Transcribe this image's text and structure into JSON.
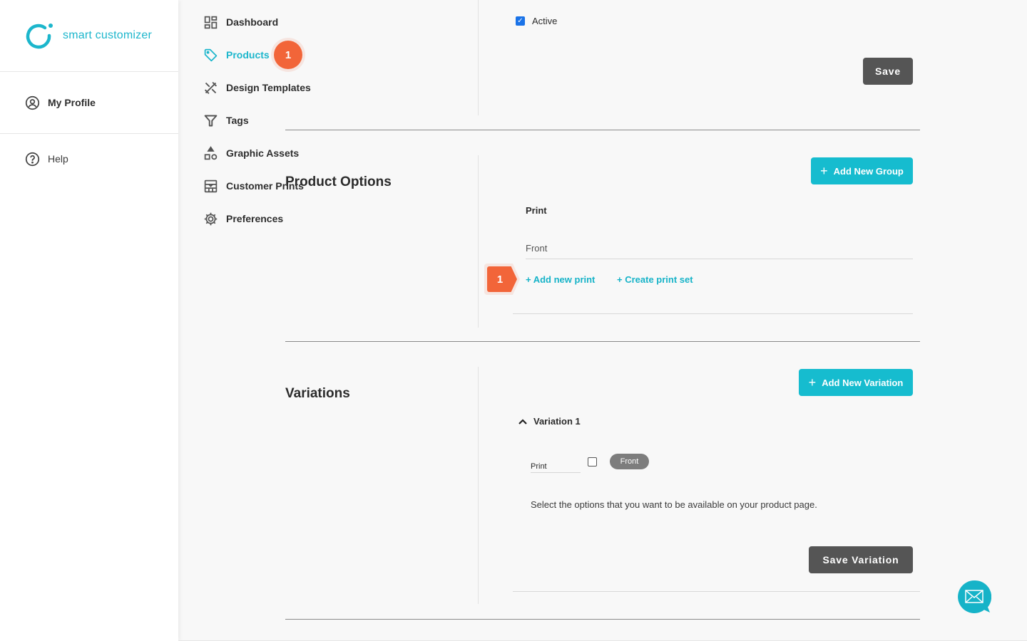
{
  "brand": {
    "name": "smart customizer",
    "accent_color": "#1cb6cc",
    "highlight_color": "#f26539"
  },
  "sidebar": {
    "profile": {
      "label": "My Profile",
      "icon": "user-circle-icon"
    },
    "items": [
      {
        "label": "Dashboard",
        "icon": "dashboard-grid-icon",
        "active": false
      },
      {
        "label": "Products",
        "icon": "tag-icon",
        "active": true,
        "badge": "1"
      },
      {
        "label": "Design Templates",
        "icon": "design-tools-icon",
        "active": false
      },
      {
        "label": "Tags",
        "icon": "filter-icon",
        "active": false
      },
      {
        "label": "Graphic Assets",
        "icon": "shapes-icon",
        "active": false
      },
      {
        "label": "Customer Prints",
        "icon": "prints-icon",
        "active": false
      },
      {
        "label": "Preferences",
        "icon": "gear-icon",
        "active": false
      }
    ],
    "help": {
      "label": "Help",
      "icon": "question-circle-icon"
    }
  },
  "general": {
    "active_label": "Active",
    "active_checked": true,
    "save_label": "Save"
  },
  "product_options": {
    "title": "Product Options",
    "add_group_label": "Add New Group",
    "group_name": "Print",
    "field_value": "Front",
    "add_print_label": "+ Add new print",
    "create_print_set_label": "+ Create print set",
    "step_badge": "1"
  },
  "variations": {
    "title": "Variations",
    "add_variation_label": "Add New Variation",
    "items": [
      {
        "name": "Variation 1",
        "expanded": true,
        "option_label": "Print",
        "option_checked": false,
        "chip_label": "Front"
      }
    ],
    "help_text": "Select the options that you want to be available on your product page.",
    "save_label": "Save Variation"
  },
  "chat": {
    "icon": "mail-icon"
  }
}
